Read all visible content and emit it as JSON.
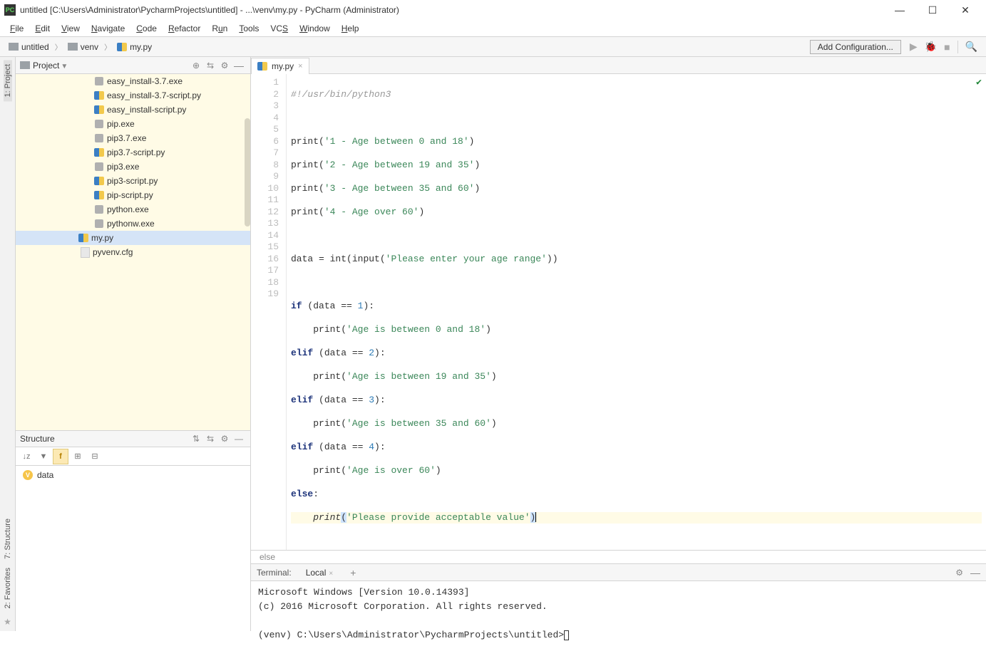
{
  "window": {
    "title": "untitled [C:\\Users\\Administrator\\PycharmProjects\\untitled] - ...\\venv\\my.py - PyCharm (Administrator)"
  },
  "menu": [
    "File",
    "Edit",
    "View",
    "Navigate",
    "Code",
    "Refactor",
    "Run",
    "Tools",
    "VCS",
    "Window",
    "Help"
  ],
  "breadcrumbs": [
    "untitled",
    "venv",
    "my.py"
  ],
  "add_config": "Add Configuration...",
  "project": {
    "title": "Project",
    "files": [
      {
        "name": "easy_install-3.7.exe",
        "type": "exe"
      },
      {
        "name": "easy_install-3.7-script.py",
        "type": "py"
      },
      {
        "name": "easy_install-script.py",
        "type": "py"
      },
      {
        "name": "pip.exe",
        "type": "exe"
      },
      {
        "name": "pip3.7.exe",
        "type": "exe"
      },
      {
        "name": "pip3.7-script.py",
        "type": "py"
      },
      {
        "name": "pip3.exe",
        "type": "exe"
      },
      {
        "name": "pip3-script.py",
        "type": "py"
      },
      {
        "name": "pip-script.py",
        "type": "py"
      },
      {
        "name": "python.exe",
        "type": "exe"
      },
      {
        "name": "pythonw.exe",
        "type": "exe"
      }
    ],
    "selected": "my.py",
    "cfg": "pyvenv.cfg"
  },
  "structure": {
    "title": "Structure",
    "node": "data"
  },
  "editor": {
    "tab": "my.py",
    "status": "else",
    "lines": 19
  },
  "code": {
    "l1": "#!/usr/bin/python3",
    "l3a": "'1 - Age between 0 and 18'",
    "l4a": "'2 - Age between 19 and 35'",
    "l5a": "'3 - Age between 35 and 60'",
    "l6a": "'4 - Age over 60'",
    "l8a": "'Please enter your age range'",
    "l11a": "'Age is between 0 and 18'",
    "l13a": "'Age is between 19 and 35'",
    "l15a": "'Age is between 35 and 60'",
    "l17a": "'Age is over 60'",
    "l19a": "'Please provide acceptable value'",
    "print": "print",
    "data": "data",
    "int": "int",
    "input": "input",
    "if": "if",
    "elif": "elif",
    "else": "else"
  },
  "terminal": {
    "label": "Terminal:",
    "tab": "Local",
    "l1": "Microsoft Windows [Version 10.0.14393]",
    "l2": "(c) 2016 Microsoft Corporation. All rights reserved.",
    "prompt": "(venv) C:\\Users\\Administrator\\PycharmProjects\\untitled>"
  },
  "sidetabs": {
    "project": "1: Project",
    "structure": "7: Structure",
    "favorites": "2: Favorites"
  }
}
